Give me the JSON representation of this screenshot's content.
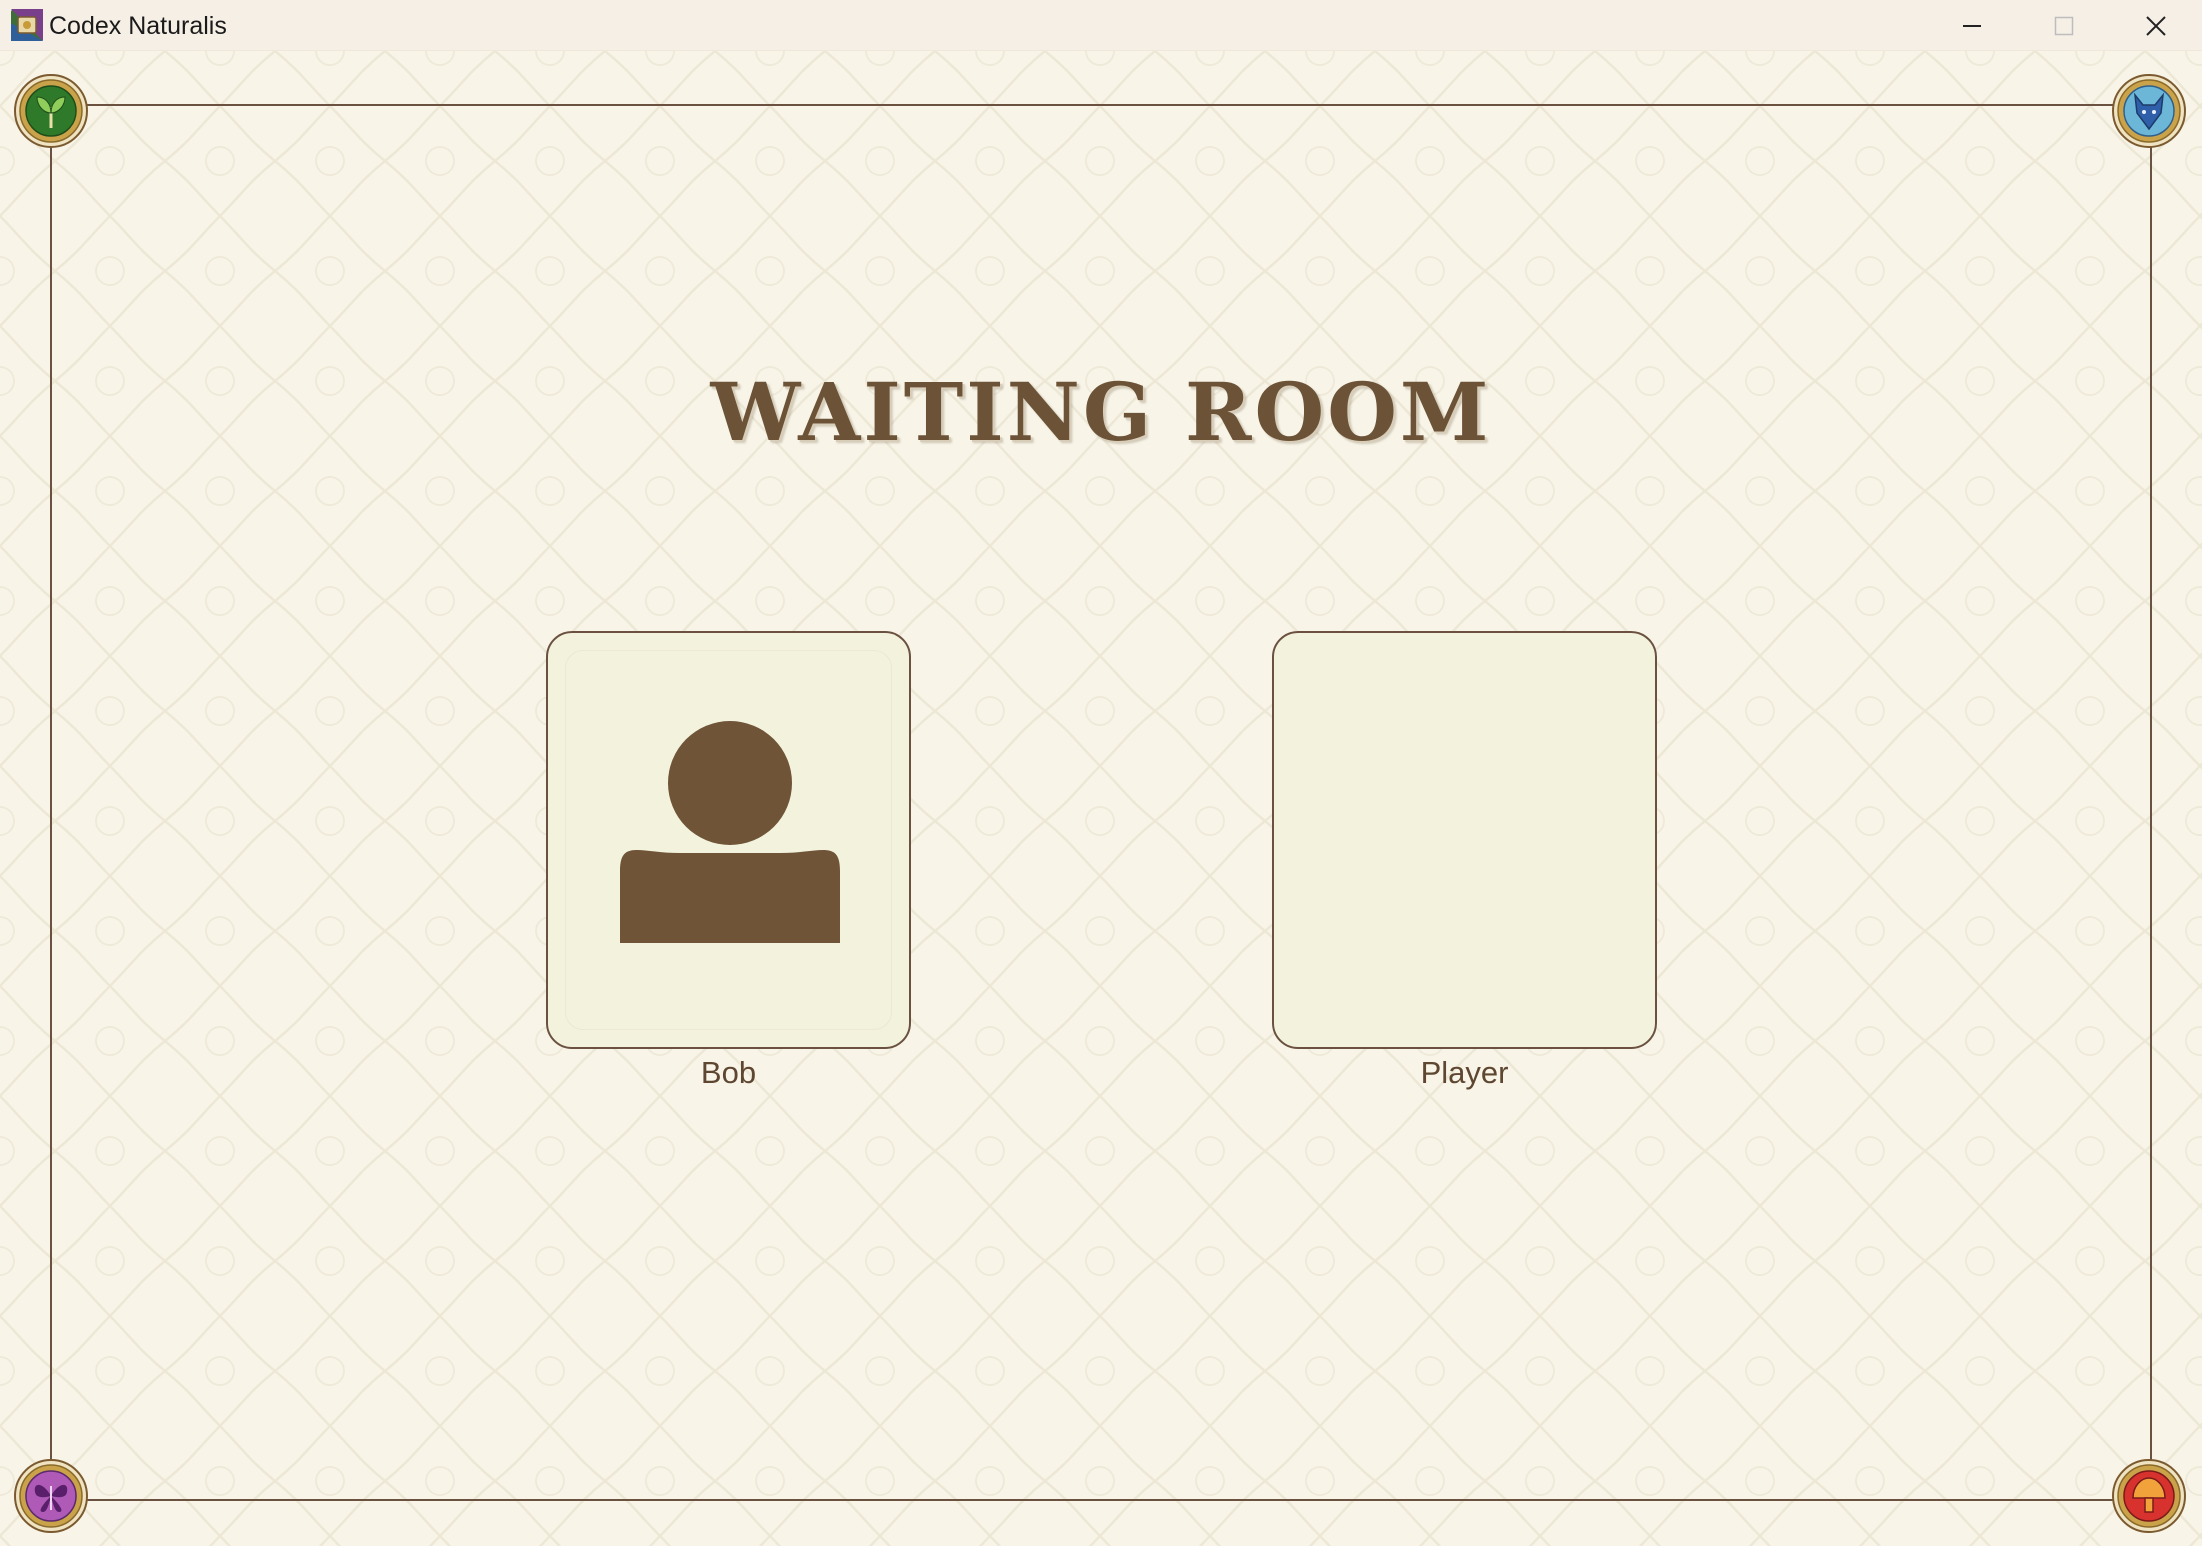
{
  "window": {
    "title": "Codex Naturalis",
    "app_icon": "codex-naturalis-app-icon",
    "controls": [
      "minimize-icon",
      "maximize-icon",
      "close-icon"
    ]
  },
  "page": {
    "title": "WAITING ROOM"
  },
  "corners": [
    {
      "name": "plant-kingdom-icon",
      "color": "#2f7a2a"
    },
    {
      "name": "animal-kingdom-icon",
      "color": "#2f6fa8"
    },
    {
      "name": "insect-kingdom-icon",
      "color": "#6a2a7a"
    },
    {
      "name": "fungi-kingdom-icon",
      "color": "#b8282a"
    }
  ],
  "players": [
    {
      "name": "Bob",
      "avatar": "person-avatar-icon"
    },
    {
      "name": "Player",
      "avatar": ""
    }
  ],
  "colors": {
    "background": "#f8f5e8",
    "accent_brown": "#6b5240",
    "slot_fill": "#f3f3dd"
  }
}
